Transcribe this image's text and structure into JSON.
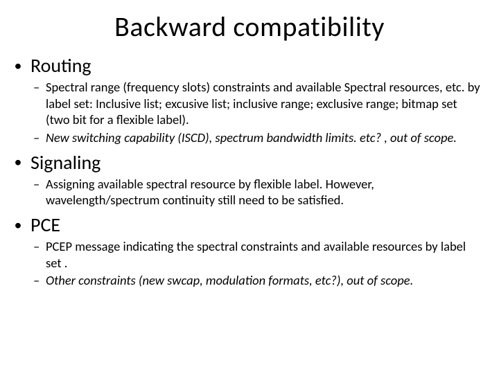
{
  "title": "Backward compatibility",
  "sections": [
    {
      "heading": "Routing",
      "items": [
        {
          "text": "Spectral range (frequency slots) constraints and available Spectral resources, etc. by label set: Inclusive list; excusive list; inclusive  range; exclusive range; bitmap set (two bit for a flexible label).",
          "italic": false
        },
        {
          "text": "New switching capability (ISCD), spectrum bandwidth limits. etc? , out of scope.",
          "italic": true
        }
      ]
    },
    {
      "heading": "Signaling",
      "items": [
        {
          "text": "Assigning available spectral resource by flexible label. However, wavelength/spectrum continuity still need to be satisfied.",
          "italic": false
        }
      ]
    },
    {
      "heading": "PCE",
      "items": [
        {
          "text": "PCEP message indicating the spectral constraints and available resources by label set .",
          "italic": false
        },
        {
          "text": "Other constraints (new swcap, modulation formats, etc?), out of scope.",
          "italic": true
        }
      ]
    }
  ]
}
